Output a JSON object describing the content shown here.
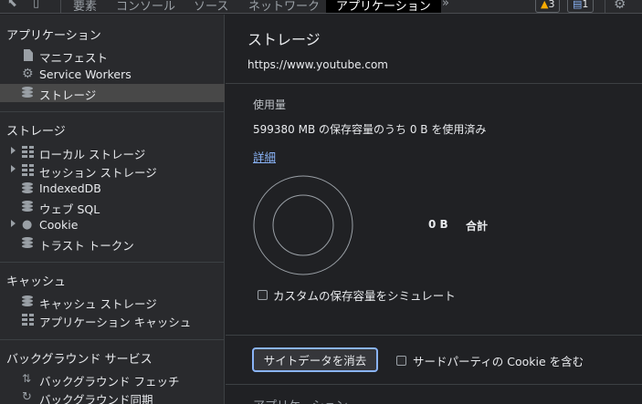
{
  "toolbar": {
    "tabs": [
      "要素",
      "コンソール",
      "ソース",
      "ネットワーク",
      "アプリケーション"
    ],
    "more": "»",
    "warnings": "3",
    "messages": "1"
  },
  "sidebar": {
    "app_header": "アプリケーション",
    "app_items": [
      "マニフェスト",
      "Service Workers",
      "ストレージ"
    ],
    "storage_header": "ストレージ",
    "storage_items": [
      "ローカル ストレージ",
      "セッション ストレージ",
      "IndexedDB",
      "ウェブ SQL",
      "Cookie",
      "トラスト トークン"
    ],
    "cache_header": "キャッシュ",
    "cache_items": [
      "キャッシュ ストレージ",
      "アプリケーション キャッシュ"
    ],
    "bg_header": "バックグラウンド サービス",
    "bg_items": [
      "バックグラウンド フェッチ",
      "バックグラウンド同期"
    ]
  },
  "main": {
    "title": "ストレージ",
    "origin": "https://www.youtube.com",
    "usage_section": "使用量",
    "usage_text": "599380 MB の保存容量のうち 0 B を使用済み",
    "details_link": "詳細",
    "total_value": "0 B",
    "total_label": "合計",
    "simulate_label": "カスタムの保存容量をシミュレート",
    "clear_button": "サイトデータを消去",
    "third_party_label": "サードパーティの Cookie を含む",
    "next_section": "アプリケーション"
  },
  "colors": {
    "accent": "#8ab4f8",
    "active_tab_bg": "#000000",
    "warning": "#f9ab00",
    "message": "#1a73e8"
  }
}
